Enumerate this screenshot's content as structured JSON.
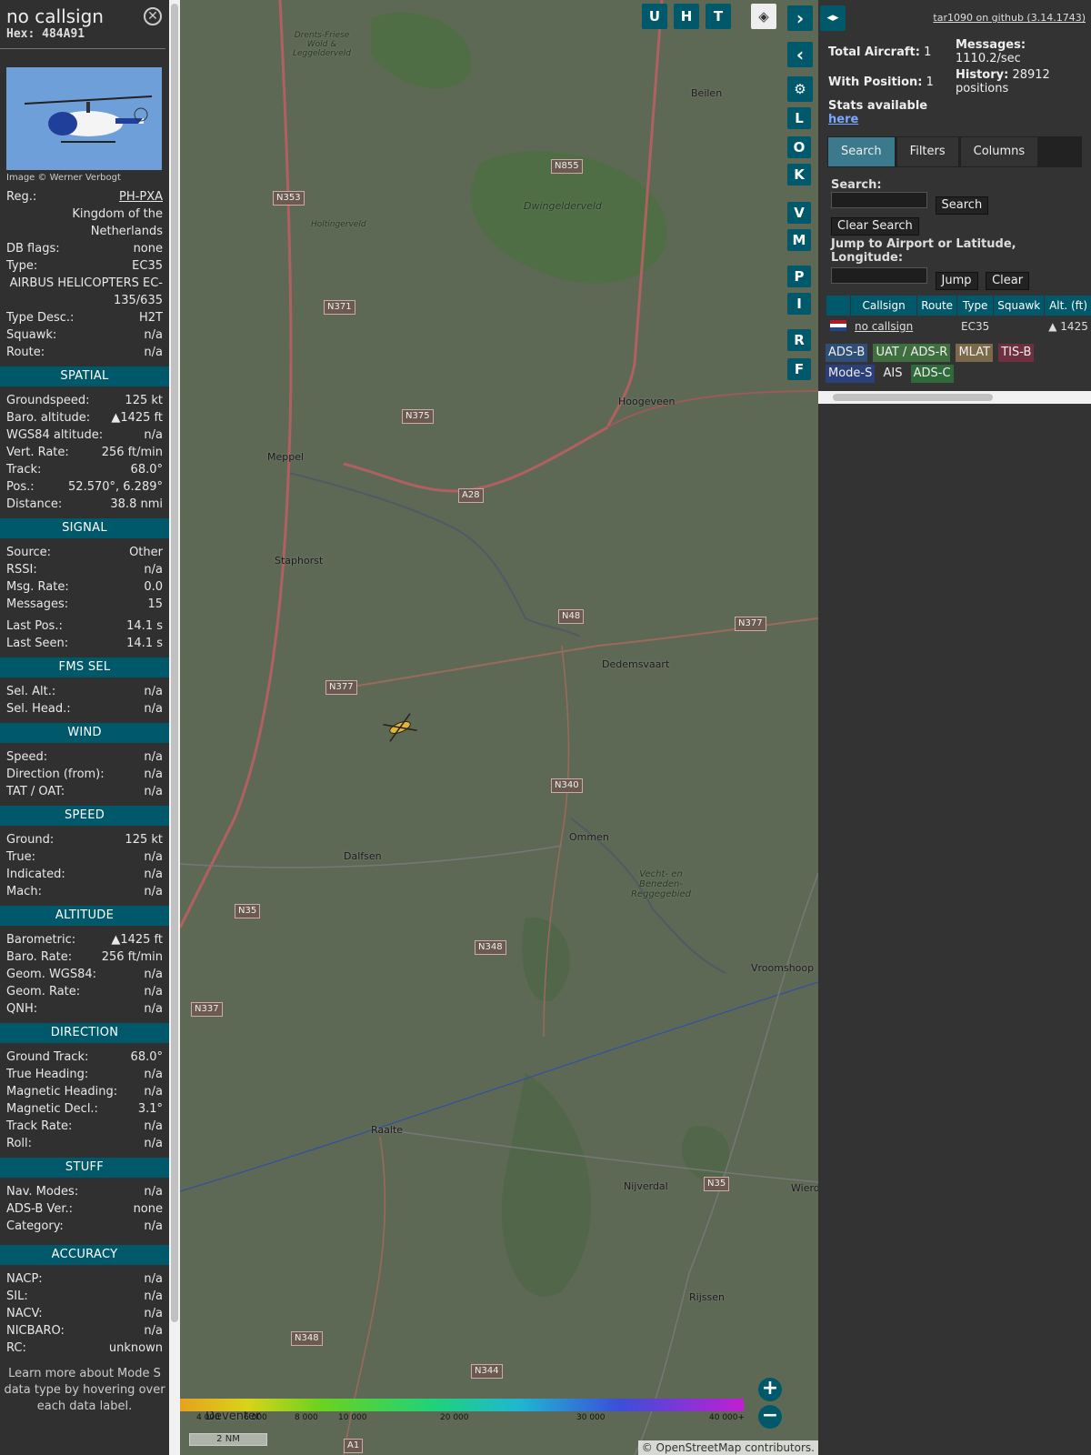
{
  "sidebar": {
    "callsign": "no callsign",
    "hex": "Hex: 484A91",
    "photo_credit": "Image © Werner Verbogt",
    "info": [
      {
        "label": "Reg.:",
        "value": "PH-PXA",
        "link": true
      },
      {
        "label": "",
        "value": "Kingdom of the Netherlands"
      },
      {
        "label": "DB flags:",
        "value": "none"
      },
      {
        "label": "Type:",
        "value": "EC35"
      },
      {
        "label": "",
        "value": "AIRBUS HELICOPTERS EC-135/635"
      },
      {
        "label": "Type Desc.:",
        "value": "H2T"
      },
      {
        "label": "Squawk:",
        "value": "n/a"
      },
      {
        "label": "Route:",
        "value": "n/a"
      }
    ],
    "sections": [
      {
        "title": "SPATIAL",
        "rows": [
          [
            "Groundspeed:",
            "125 kt"
          ],
          [
            "Baro. altitude:",
            "▲1425 ft"
          ],
          [
            "WGS84 altitude:",
            "n/a"
          ],
          [
            "Vert. Rate:",
            "256 ft/min"
          ],
          [
            "Track:",
            "68.0°"
          ],
          [
            "Pos.:",
            "52.570°, 6.289°"
          ],
          [
            "Distance:",
            "38.8 nmi"
          ]
        ]
      },
      {
        "title": "SIGNAL",
        "rows": [
          [
            "Source:",
            "Other"
          ],
          [
            "RSSI:",
            "n/a"
          ],
          [
            "Msg. Rate:",
            "0.0"
          ],
          [
            "Messages:",
            "15"
          ],
          [
            "",
            ""
          ],
          [
            "Last Pos.:",
            "14.1 s"
          ],
          [
            "Last Seen:",
            "14.1 s"
          ]
        ]
      },
      {
        "title": "FMS SEL",
        "rows": [
          [
            "Sel. Alt.:",
            "n/a"
          ],
          [
            "Sel. Head.:",
            "n/a"
          ]
        ]
      },
      {
        "title": "WIND",
        "rows": [
          [
            "Speed:",
            "n/a"
          ],
          [
            "Direction (from):",
            "n/a"
          ],
          [
            "TAT / OAT:",
            "n/a"
          ]
        ]
      },
      {
        "title": "SPEED",
        "rows": [
          [
            "Ground:",
            "125 kt"
          ],
          [
            "True:",
            "n/a"
          ],
          [
            "Indicated:",
            "n/a"
          ],
          [
            "Mach:",
            "n/a"
          ]
        ]
      },
      {
        "title": "ALTITUDE",
        "rows": [
          [
            "Barometric:",
            "▲1425 ft"
          ],
          [
            "Baro. Rate:",
            "256 ft/min"
          ],
          [
            "Geom. WGS84:",
            "n/a"
          ],
          [
            "Geom. Rate:",
            "n/a"
          ],
          [
            "QNH:",
            "n/a"
          ]
        ]
      },
      {
        "title": "DIRECTION",
        "rows": [
          [
            "Ground Track:",
            "68.0°"
          ],
          [
            "True Heading:",
            "n/a"
          ],
          [
            "Magnetic Heading:",
            "n/a"
          ],
          [
            "Magnetic Decl.:",
            "3.1°"
          ],
          [
            "Track Rate:",
            "n/a"
          ],
          [
            "Roll:",
            "n/a"
          ]
        ]
      },
      {
        "title": "STUFF",
        "rows": [
          [
            "Nav. Modes:",
            "n/a"
          ],
          [
            "ADS-B Ver.:",
            "none"
          ],
          [
            "Category:",
            "n/a"
          ],
          [
            "",
            ""
          ]
        ]
      },
      {
        "title": "ACCURACY",
        "rows": [
          [
            "NACP:",
            "n/a"
          ],
          [
            "SIL:",
            "n/a"
          ],
          [
            "NACV:",
            "n/a"
          ],
          [
            "NICBARO:",
            "n/a"
          ],
          [
            "RC:",
            "unknown"
          ]
        ]
      }
    ],
    "learn_more": "Learn more about Mode S data type by hovering over each data label."
  },
  "map": {
    "buttons": [
      "U",
      "H",
      "T"
    ],
    "side_buttons": [
      "L",
      "O",
      "K",
      "V",
      "M",
      "P",
      "I",
      "R",
      "F"
    ],
    "places": [
      "Meppel",
      "Staphorst",
      "Hoogeveen",
      "Dedemsvaart",
      "Ommen",
      "Dalfsen",
      "Raalte",
      "Nijverdal",
      "Rijssen",
      "Vroomshoop",
      "Beilen",
      "Dwingelderveld",
      "Holtingerveld",
      "Vecht- en Beneden-Reggegebied",
      "Drents-Friese Wold & Leggelderveld",
      "Deventer",
      "Wierd"
    ],
    "roads": [
      "N855",
      "N353",
      "N371",
      "N375",
      "A28",
      "N48",
      "N377",
      "N377",
      "N340",
      "N35",
      "N348",
      "N337",
      "N35",
      "N348",
      "N344",
      "A1"
    ],
    "alt_labels": [
      "4 000",
      "6 000",
      "8 000",
      "10 000",
      "20 000",
      "30 000",
      "40 000+"
    ],
    "scale": "2 NM",
    "attribution": "© OpenStreetMap contributors."
  },
  "right": {
    "github": "tar1090 on github (3.14.1743)",
    "total_aircraft_label": "Total Aircraft:",
    "total_aircraft": "1",
    "with_position_label": "With Position:",
    "with_position": "1",
    "messages_label": "Messages:",
    "messages": "1110.2/sec",
    "history_label": "History:",
    "history": "28912 positions",
    "stats_label": "Stats available",
    "stats_link": "here",
    "tabs": [
      "Search",
      "Filters",
      "Columns"
    ],
    "search_label": "Search:",
    "search_btn": "Search",
    "clear_search_btn": "Clear Search",
    "jump_label": "Jump to Airport or Latitude, Longitude:",
    "jump_btn": "Jump",
    "clear_btn": "Clear",
    "table": {
      "headers": [
        "",
        "Callsign",
        "Route",
        "Type",
        "Squawk",
        "Alt. (ft)"
      ],
      "row": {
        "callsign": "no callsign",
        "route": "",
        "type": "EC35",
        "squawk": "",
        "alt": "▲ 1425"
      }
    },
    "badges": [
      "ADS-B",
      "UAT / ADS-R",
      "MLAT",
      "TIS-B",
      "Mode-S",
      "AIS",
      "ADS-C"
    ]
  },
  "colors": {
    "accent": "#00596b",
    "tab_active": "#3a7a8c",
    "panel": "#303030"
  }
}
